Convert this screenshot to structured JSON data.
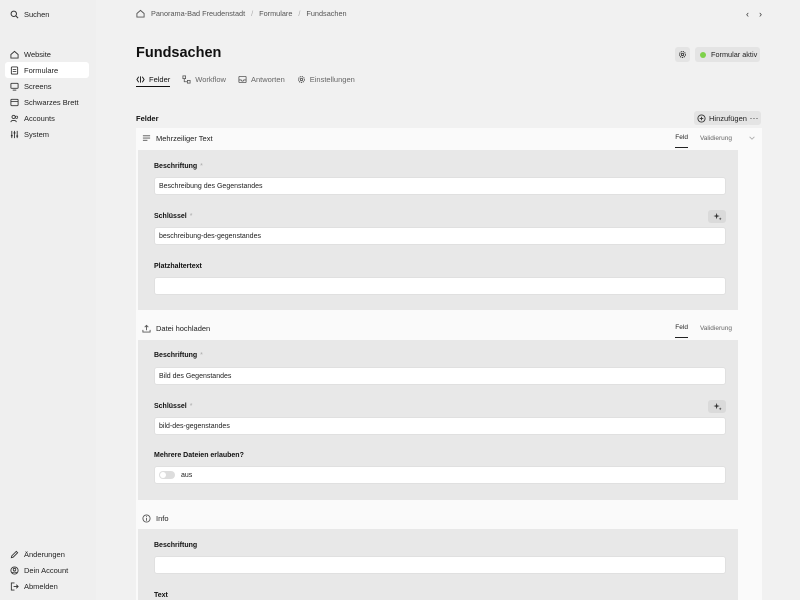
{
  "sidebar": {
    "search_label": "Suchen",
    "items": [
      {
        "label": "Website",
        "icon": "home-icon"
      },
      {
        "label": "Formulare",
        "icon": "form-icon",
        "active": true
      },
      {
        "label": "Screens",
        "icon": "screen-icon"
      },
      {
        "label": "Schwarzes Brett",
        "icon": "board-icon"
      },
      {
        "label": "Accounts",
        "icon": "users-icon"
      },
      {
        "label": "System",
        "icon": "sliders-icon"
      }
    ],
    "bottom_items": [
      {
        "label": "Änderungen",
        "icon": "pen-icon"
      },
      {
        "label": "Dein Account",
        "icon": "account-icon"
      },
      {
        "label": "Abmelden",
        "icon": "logout-icon"
      }
    ]
  },
  "breadcrumb": [
    "Panorama-Bad Freudenstadt",
    "Formulare",
    "Fundsachen"
  ],
  "page": {
    "title": "Fundsachen",
    "status_label": "Formular aktiv",
    "status_color": "#7ed14a"
  },
  "tabs": [
    {
      "label": "Felder",
      "icon": "fields-icon",
      "active": true
    },
    {
      "label": "Workflow",
      "icon": "workflow-icon"
    },
    {
      "label": "Antworten",
      "icon": "inbox-icon"
    },
    {
      "label": "Einstellungen",
      "icon": "gear-icon"
    }
  ],
  "fields_section": {
    "label": "Felder",
    "add_label": "Hinzufügen",
    "more_label": "···"
  },
  "field_tab_labels": {
    "field": "Feld",
    "validation": "Validierung"
  },
  "fields": [
    {
      "type_label": "Mehrzeiliger Text",
      "icon": "text-lines-icon",
      "caption_label": "Beschriftung",
      "caption_value": "Beschreibung des Gegenstandes",
      "key_label": "Schlüssel",
      "key_value": "beschreibung-des-gegenstandes",
      "placeholder_label": "Platzhaltertext",
      "placeholder_value": ""
    },
    {
      "type_label": "Datei hochladen",
      "icon": "upload-icon",
      "caption_label": "Beschriftung",
      "caption_value": "Bild des Gegenstandes",
      "key_label": "Schlüssel",
      "key_value": "bild-des-gegenstandes",
      "multi_label": "Mehrere Dateien erlauben?",
      "multi_value": "aus"
    },
    {
      "type_label": "Info",
      "icon": "info-icon",
      "caption_label": "Beschriftung",
      "caption_value": "",
      "text_label": "Text"
    }
  ],
  "required_mark": "*"
}
